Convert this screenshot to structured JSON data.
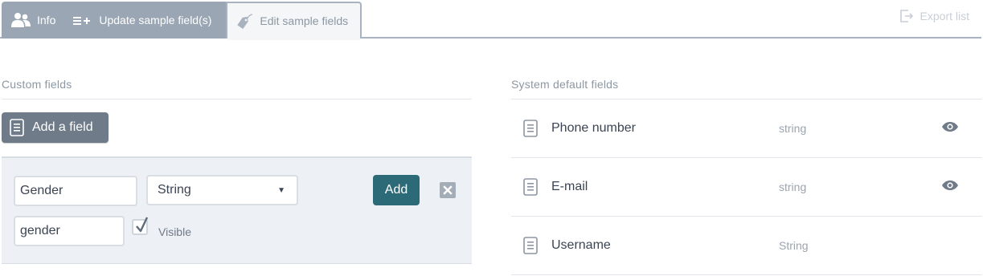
{
  "tabs": [
    {
      "label": "Info",
      "icon": "users-icon",
      "active": false
    },
    {
      "label": "Update sample field(s)",
      "icon": "list-add-icon",
      "active": false
    },
    {
      "label": "Edit sample fields",
      "icon": "tag-icon",
      "active": true
    }
  ],
  "toolbar": {
    "export_label": "Export list",
    "export_icon": "export-icon"
  },
  "custom_fields": {
    "title": "Custom fields",
    "add_field_label": "Add a field",
    "new_field": {
      "name_value": "Gender",
      "type_value": "String",
      "key_value": "gender",
      "add_label": "Add",
      "visible_label": "Visible",
      "visible_checked": true
    }
  },
  "system_fields": {
    "title": "System default fields",
    "rows": [
      {
        "name": "Phone number",
        "type": "string",
        "visible_icon": true
      },
      {
        "name": "E-mail",
        "type": "string",
        "visible_icon": true
      },
      {
        "name": "Username",
        "type": "String",
        "visible_icon": false
      }
    ]
  },
  "colors": {
    "tab_bg": "#9aa6b3",
    "active_tab_bg": "#f4f6f8",
    "add_button": "#2d6a77",
    "add_field_button": "#6f7b88",
    "panel_bg": "#edf0f4"
  }
}
